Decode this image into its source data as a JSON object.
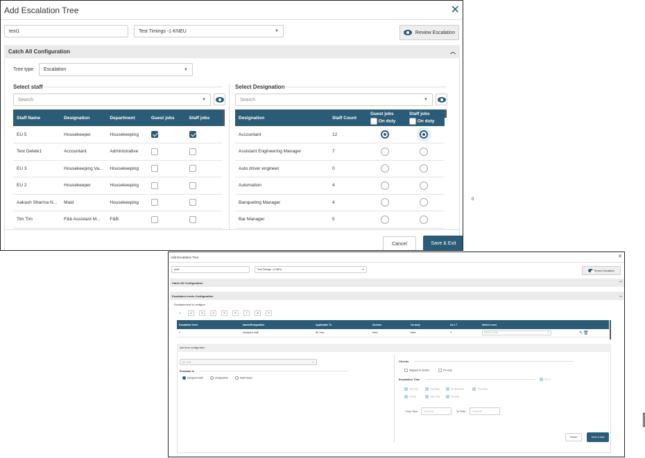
{
  "dialog1": {
    "title": "Add Escalation Tree",
    "name_value": "test1",
    "timing_value": "Test Timings -1-KNEU",
    "review_label": "Review Escalation",
    "catch_all_label": "Catch All Configuration",
    "tree_type_label": "Tree type",
    "tree_type_value": "Escalation",
    "select_staff_label": "Select staff",
    "select_designation_label": "Select Designation",
    "search_placeholder": "Search",
    "staff_headers": [
      "Staff Name",
      "Designation",
      "Department",
      "Guest jobs",
      "Staff jobs"
    ],
    "staff_rows": [
      {
        "name": "EU 5",
        "designation": "Housekeeper",
        "department": "Housekeeping",
        "guest": true,
        "staff": true
      },
      {
        "name": "Test Delete1",
        "designation": "Accountant",
        "department": "Administrative",
        "guest": false,
        "staff": false
      },
      {
        "name": "EU 3",
        "designation": "Housekeeping Va...",
        "department": "Housekeeping",
        "guest": false,
        "staff": false
      },
      {
        "name": "EU 2",
        "designation": "Housekeeper",
        "department": "Housekeeping",
        "guest": false,
        "staff": false
      },
      {
        "name": "Aakash Sharma N...",
        "designation": "Maid",
        "department": "Housekeeping",
        "guest": false,
        "staff": false
      },
      {
        "name": "Tim Tim",
        "designation": "F&b Assistant M...",
        "department": "F&B",
        "guest": false,
        "staff": false
      }
    ],
    "desig_headers": {
      "designation": "Designation",
      "count": "Staff Count",
      "guest": "Guest jobs",
      "staff": "Staff jobs",
      "on_duty": "On duty"
    },
    "desig_rows": [
      {
        "designation": "Accountant",
        "count": "12",
        "selected": true
      },
      {
        "designation": "Assistant Engineering Manager",
        "count": "7",
        "selected": false
      },
      {
        "designation": "Auto driver engineer",
        "count": "0",
        "selected": false
      },
      {
        "designation": "Automation",
        "count": "4",
        "selected": false
      },
      {
        "designation": "Banqueting Manager",
        "count": "4",
        "selected": false
      },
      {
        "designation": "Bar Manager",
        "count": "5",
        "selected": false
      }
    ],
    "cancel_label": "Cancel",
    "save_exit_label": "Save & Exit",
    "stray_text": "0"
  },
  "dialog2": {
    "title": "Add Escalation Tree",
    "name_value": "test1",
    "timing_value": "Test Timings -1-KNEU",
    "review_label": "Review Escalation",
    "catch_all_label": "Catch All Configuration",
    "levels_config_label": "Escalation levels Configuration",
    "levels_hint": "Escalation level to configure",
    "levels": [
      "1",
      "2",
      "3",
      "4",
      "5",
      "6",
      "7",
      "8",
      "9"
    ],
    "table_headers": [
      "Escalation level",
      "Name/Designation",
      "Applicable To",
      "Section",
      "On duty",
      "24 x 7",
      "Select Level"
    ],
    "table_row": [
      "1",
      "Assigned staff",
      "All Jobs",
      "false",
      "false",
      "Y",
      "Select Level"
    ],
    "add_level_label": "Add level configuration",
    "all_jobs_value": "All Jobs",
    "escalate_to_label": "Escalate to",
    "escalate_options": [
      "Assigned staff",
      "Designation",
      "Staff Name"
    ],
    "checks_label": "Checks",
    "check_options": [
      "Mapped to section",
      "On duty"
    ],
    "escalation_time_label": "Escalation Time",
    "all_day_label": "24 x 7",
    "days": [
      "Monday",
      "Tuesday",
      "Wednesday",
      "Thursday",
      "Friday",
      "Saturday",
      "Sunday"
    ],
    "from_time_label": "From Time",
    "from_time_value": "00:00:00",
    "to_time_label": "To Time",
    "to_time_value": "23:59:59",
    "reset_label": "Reset",
    "save_add_label": "Save & Add"
  },
  "colors": {
    "accent": "#2b5c77"
  }
}
